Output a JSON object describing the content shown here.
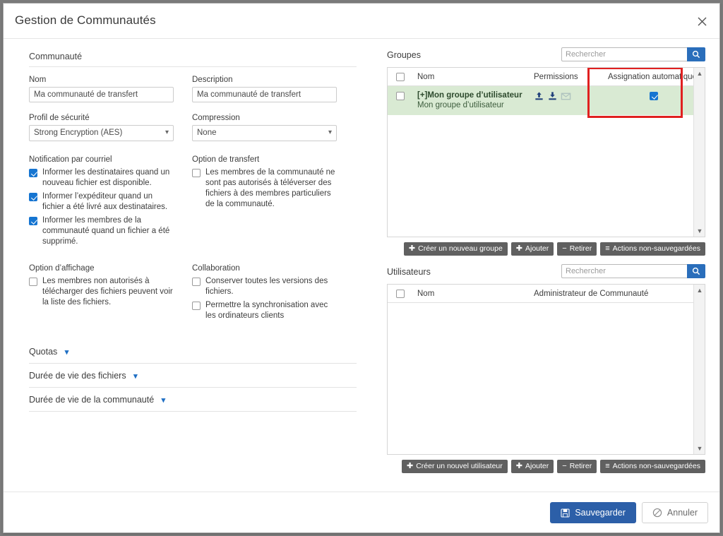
{
  "window": {
    "title": "Gestion de Communautés",
    "close_icon": "close-icon"
  },
  "community": {
    "section_title": "Communauté",
    "name_label": "Nom",
    "name_value": "Ma communauté de transfert",
    "description_label": "Description",
    "description_value": "Ma communauté de transfert",
    "security_profile_label": "Profil de sécurité",
    "security_profile_value": "Strong Encryption (AES)",
    "compression_label": "Compression",
    "compression_value": "None"
  },
  "email_notification": {
    "label": "Notification par courriel",
    "options": [
      {
        "text": "Informer les destinataires quand un nouveau fichier est disponible.",
        "checked": true
      },
      {
        "text": "Informer l’expéditeur quand un fichier a été livré aux destinataires.",
        "checked": true
      },
      {
        "text": "Informer les membres de la communauté quand un fichier a été supprimé.",
        "checked": true
      }
    ]
  },
  "transfer_option": {
    "label": "Option de transfert",
    "options": [
      {
        "text": "Les membres de la communauté ne sont pas autorisés à téléverser des fichiers à des membres particuliers de la communauté.",
        "checked": false
      }
    ]
  },
  "display_option": {
    "label": "Option d’affichage",
    "options": [
      {
        "text": "Les membres non autorisés à télécharger des fichiers peuvent voir la liste des fichiers.",
        "checked": false
      }
    ]
  },
  "collaboration": {
    "label": "Collaboration",
    "options": [
      {
        "text": "Conserver toutes les versions des fichiers.",
        "checked": false
      },
      {
        "text": "Permettre la synchronisation avec les ordinateurs clients",
        "checked": false
      }
    ]
  },
  "accordions": [
    {
      "label": "Quotas",
      "icon": "chevron-down-icon"
    },
    {
      "label": "Durée de vie des fichiers",
      "icon": "chevron-down-icon"
    },
    {
      "label": "Durée de vie de la communauté",
      "icon": "chevron-down-icon"
    }
  ],
  "groups_panel": {
    "title": "Groupes",
    "search_placeholder": "Rechercher",
    "search_value": "",
    "search_icon": "search-icon",
    "columns": {
      "name": "Nom",
      "permissions": "Permissions",
      "auto_assign": "Assignation automatique"
    },
    "rows": [
      {
        "selected": false,
        "name": "[+]Mon groupe d’utilisateur",
        "subname": "Mon groupe d’utilisateur",
        "permissions": [
          "upload-icon",
          "download-icon",
          "mail-icon-disabled"
        ],
        "auto_assign": true,
        "row_highlight_color": "#d9ead3"
      }
    ],
    "buttons": [
      {
        "label": "Créer un nouveau groupe",
        "icon": "plus-icon"
      },
      {
        "label": "Ajouter",
        "icon": "plus-icon"
      },
      {
        "label": "Retirer",
        "icon": "minus-icon"
      },
      {
        "label": "Actions non-sauvegardées",
        "icon": "list-icon"
      }
    ],
    "highlight_color": "#e02020"
  },
  "users_panel": {
    "title": "Utilisateurs",
    "search_placeholder": "Rechercher",
    "search_value": "",
    "search_icon": "search-icon",
    "columns": {
      "name": "Nom",
      "community_admin": "Administrateur de Communauté"
    },
    "rows": [],
    "buttons": [
      {
        "label": "Créer un nouvel utilisateur",
        "icon": "plus-icon"
      },
      {
        "label": "Ajouter",
        "icon": "plus-icon"
      },
      {
        "label": "Retirer",
        "icon": "minus-icon"
      },
      {
        "label": "Actions non-sauvegardées",
        "icon": "list-icon"
      }
    ]
  },
  "footer": {
    "save_label": "Sauvegarder",
    "cancel_label": "Annuler",
    "save_icon": "save-disk-icon",
    "cancel_icon": "ban-icon",
    "accent_color": "#2c5fa8"
  }
}
